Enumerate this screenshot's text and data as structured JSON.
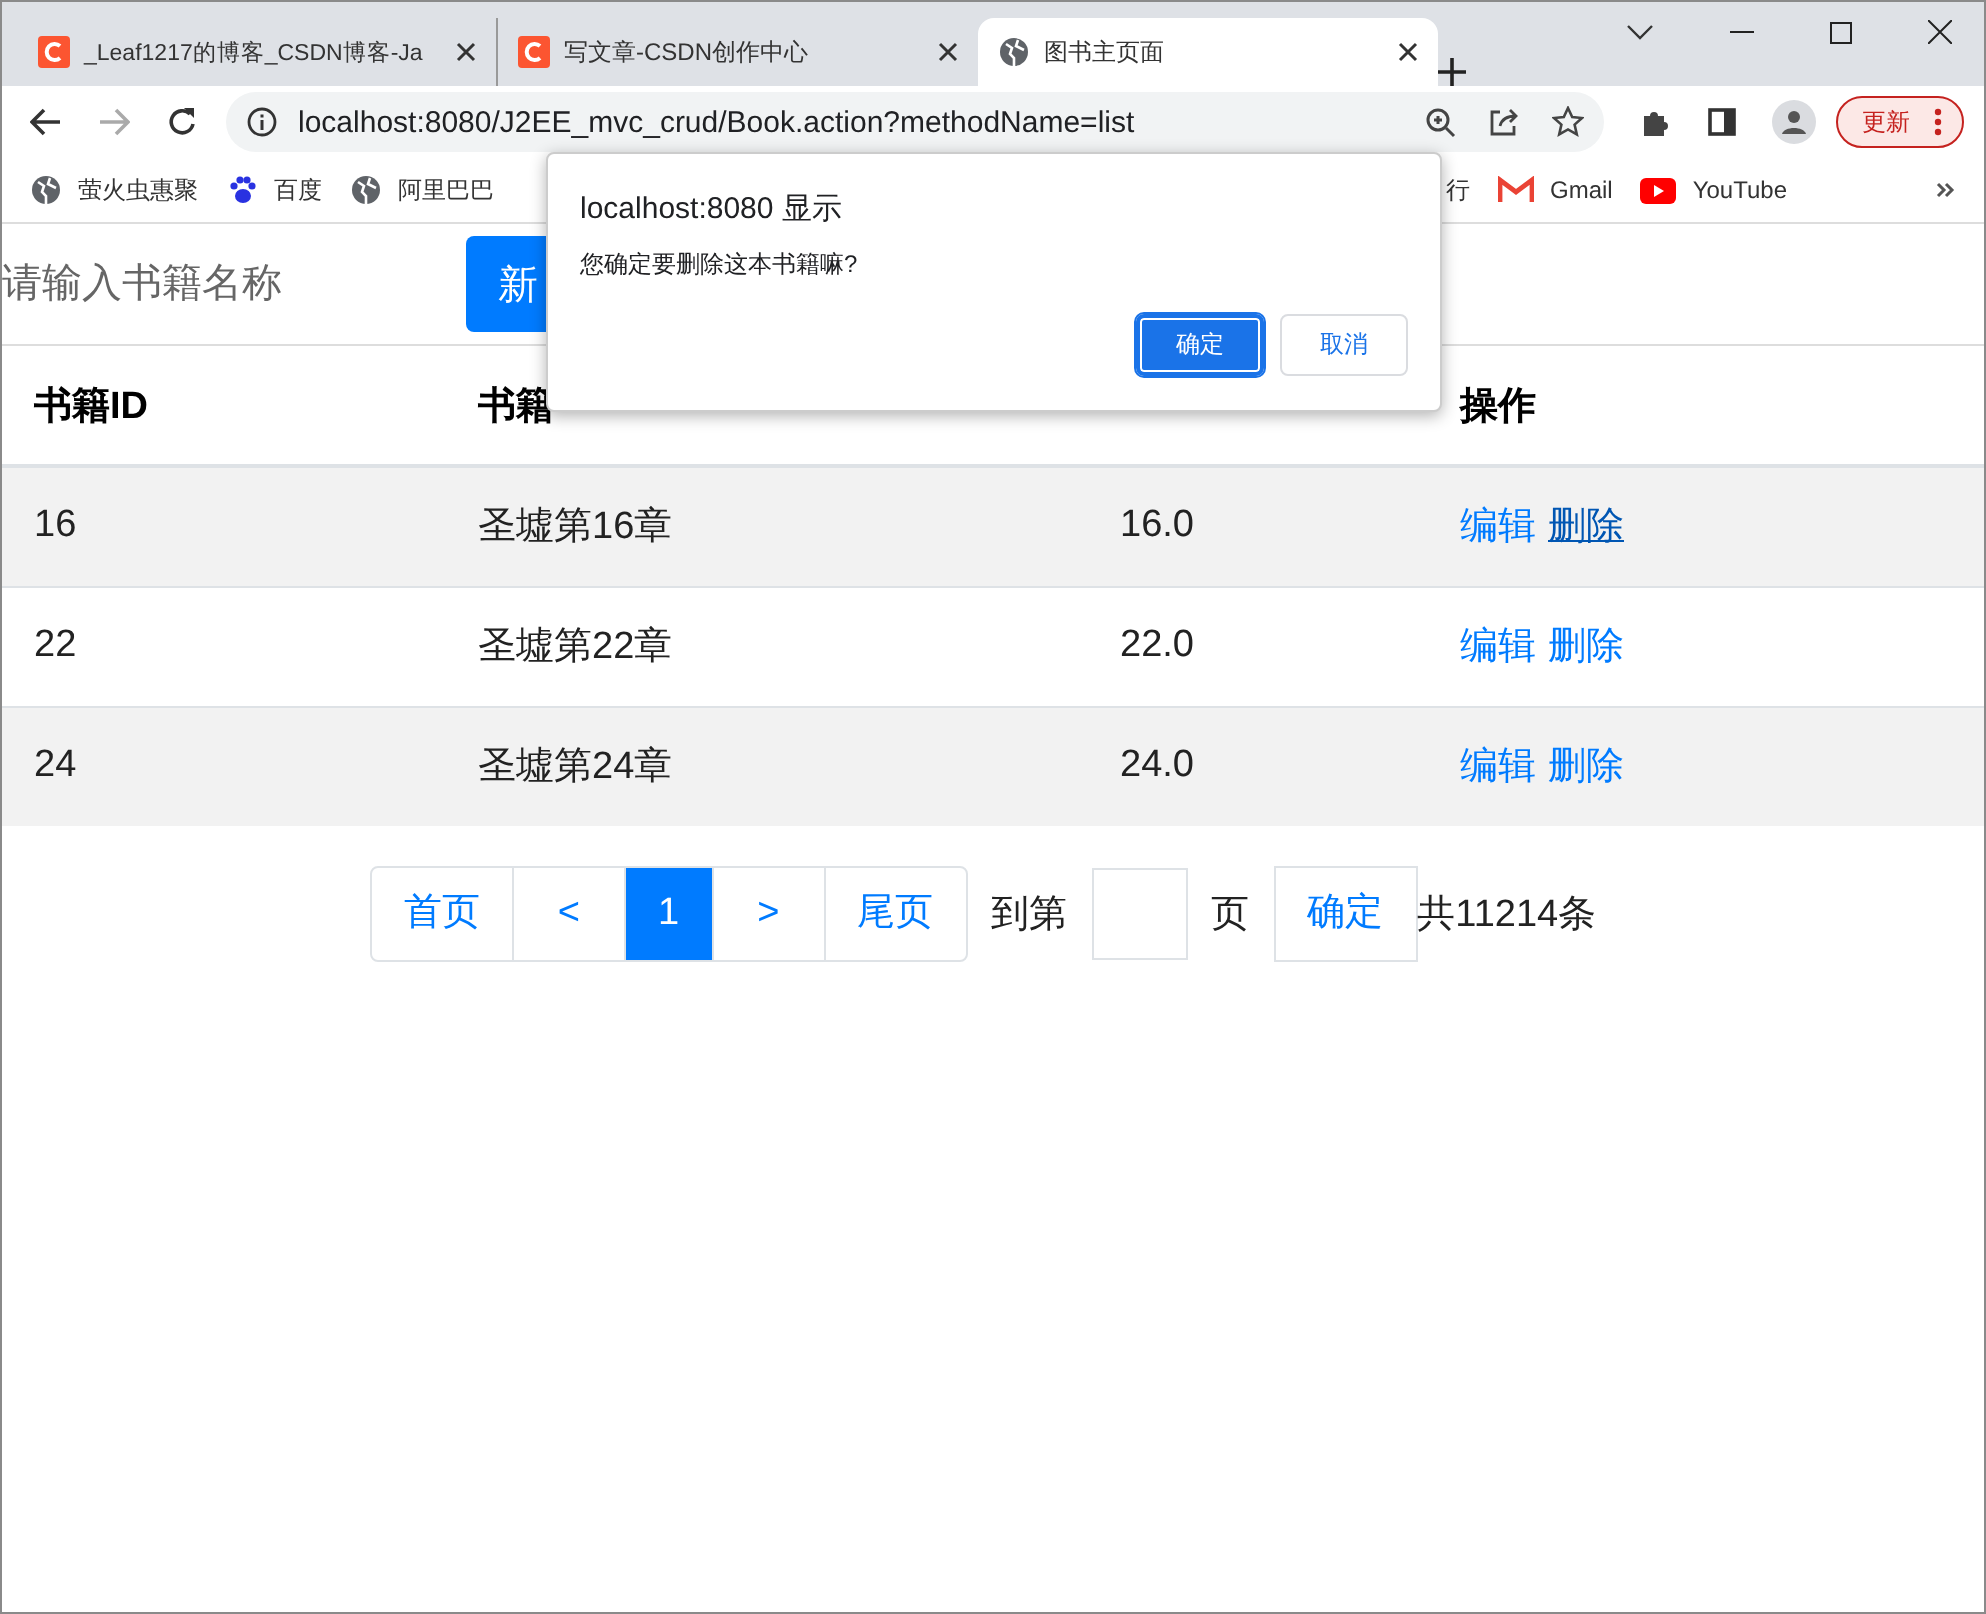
{
  "browser": {
    "tabs": [
      {
        "title": "_Leaf1217的博客_CSDN博客-Ja",
        "selected": false
      },
      {
        "title": "写文章-CSDN创作中心",
        "selected": false
      },
      {
        "title": "图书主页面",
        "selected": true
      }
    ],
    "address": "localhost:8080/J2EE_mvc_crud/Book.action?methodName=list",
    "update_button": "更新",
    "bookmarks": [
      {
        "label": "萤火虫惠聚"
      },
      {
        "label": "百度"
      },
      {
        "label": "阿里巴巴"
      },
      {
        "label": "行"
      },
      {
        "label": "Gmail"
      },
      {
        "label": "YouTube"
      }
    ]
  },
  "search": {
    "placeholder": "请输入书籍名称"
  },
  "add_button": "新",
  "table": {
    "columns": [
      "书籍ID",
      "书籍",
      "",
      "操作"
    ],
    "rows": [
      {
        "cells": [
          "16",
          "圣墟第16章",
          "16.0"
        ],
        "actions": [
          {
            "label": "编辑",
            "hover": false
          },
          {
            "label": "删除",
            "hover": true
          }
        ]
      },
      {
        "cells": [
          "22",
          "圣墟第22章",
          "22.0"
        ],
        "actions": [
          {
            "label": "编辑",
            "hover": false
          },
          {
            "label": "删除",
            "hover": false
          }
        ]
      },
      {
        "cells": [
          "24",
          "圣墟第24章",
          "24.0"
        ],
        "actions": [
          {
            "label": "编辑",
            "hover": false
          },
          {
            "label": "删除",
            "hover": false
          }
        ]
      }
    ]
  },
  "pagination": {
    "pages": [
      {
        "label": "首页",
        "selected": false
      },
      {
        "label": "<",
        "selected": false
      },
      {
        "label": "1",
        "selected": true
      },
      {
        "label": ">",
        "selected": false
      },
      {
        "label": "尾页",
        "selected": false
      }
    ],
    "goto_label": "到第",
    "page_unit": "页",
    "goto_button": "确定",
    "total": "共11214条"
  },
  "dialog": {
    "title": "localhost:8080 显示",
    "message": "您确定要删除这本书籍嘛?",
    "buttons": [
      {
        "label": "确定",
        "kind": "primary"
      },
      {
        "label": "取消",
        "kind": "secondary"
      }
    ]
  }
}
